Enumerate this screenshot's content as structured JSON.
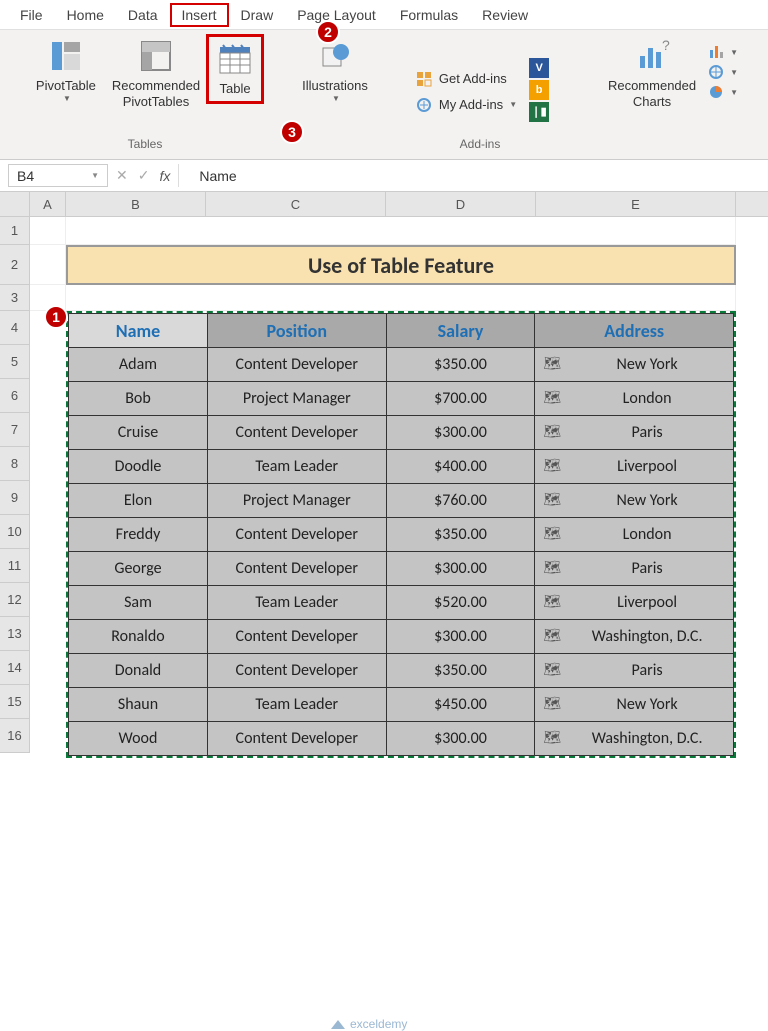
{
  "ribbon": {
    "tabs": [
      "File",
      "Home",
      "Data",
      "Insert",
      "Draw",
      "Page Layout",
      "Formulas",
      "Review"
    ],
    "active_tab": "Insert",
    "groups": {
      "tables": {
        "label": "Tables",
        "pivottable": "PivotTable",
        "recommended_pt": "Recommended\nPivotTables",
        "table": "Table"
      },
      "illustrations": {
        "label": "Illustrations"
      },
      "addins": {
        "label": "Add-ins",
        "get": "Get Add-ins",
        "my": "My Add-ins"
      },
      "charts": {
        "recommended": "Recommended\nCharts"
      }
    }
  },
  "namebox": {
    "value": "B4"
  },
  "formula_bar": {
    "value": "Name",
    "fx": "fx"
  },
  "columns": [
    "A",
    "B",
    "C",
    "D",
    "E"
  ],
  "sheet": {
    "title": "Use of Table Feature",
    "headers": [
      "Name",
      "Position",
      "Salary",
      "Address"
    ],
    "rows": [
      {
        "name": "Adam",
        "position": "Content Developer",
        "salary": "$350.00",
        "address": "New York"
      },
      {
        "name": "Bob",
        "position": "Project Manager",
        "salary": "$700.00",
        "address": "London"
      },
      {
        "name": "Cruise",
        "position": "Content Developer",
        "salary": "$300.00",
        "address": "Paris"
      },
      {
        "name": "Doodle",
        "position": "Team Leader",
        "salary": "$400.00",
        "address": "Liverpool"
      },
      {
        "name": "Elon",
        "position": "Project Manager",
        "salary": "$760.00",
        "address": "New York"
      },
      {
        "name": "Freddy",
        "position": "Content Developer",
        "salary": "$350.00",
        "address": "London"
      },
      {
        "name": "George",
        "position": "Content Developer",
        "salary": "$300.00",
        "address": "Paris"
      },
      {
        "name": "Sam",
        "position": "Team Leader",
        "salary": "$520.00",
        "address": "Liverpool"
      },
      {
        "name": "Ronaldo",
        "position": "Content Developer",
        "salary": "$300.00",
        "address": "Washington, D.C."
      },
      {
        "name": "Donald",
        "position": "Content Developer",
        "salary": "$350.00",
        "address": "Paris"
      },
      {
        "name": "Shaun",
        "position": "Team Leader",
        "salary": "$450.00",
        "address": "New York"
      },
      {
        "name": "Wood",
        "position": "Content Developer",
        "salary": "$300.00",
        "address": "Washington, D.C."
      }
    ]
  },
  "annotations": {
    "b1": "1",
    "b2": "2",
    "b3": "3"
  },
  "watermark": "exceldemy"
}
